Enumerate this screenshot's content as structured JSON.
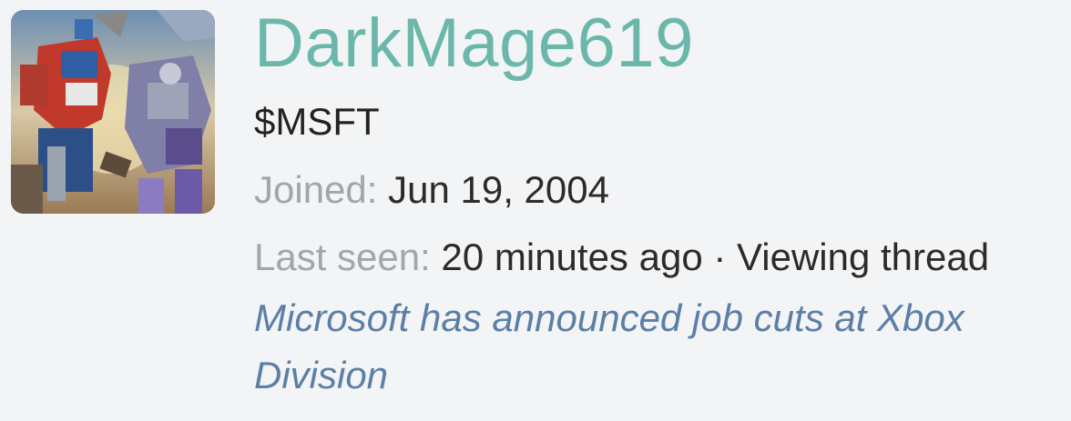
{
  "profile": {
    "username": "DarkMage619",
    "user_title": "$MSFT",
    "joined_label": "Joined:",
    "joined_value": "Jun 19, 2004",
    "last_seen_label": "Last seen:",
    "last_seen_value": "20 minutes ago",
    "separator": " · ",
    "activity": "Viewing thread",
    "thread_title": "Microsoft has announced job cuts at Xbox Division"
  },
  "colors": {
    "background": "#f3f4f6",
    "username": "#6bb8ab",
    "muted_label": "#a2a5a9",
    "value_text": "#2b2b2b",
    "link": "#5b7fa6"
  }
}
